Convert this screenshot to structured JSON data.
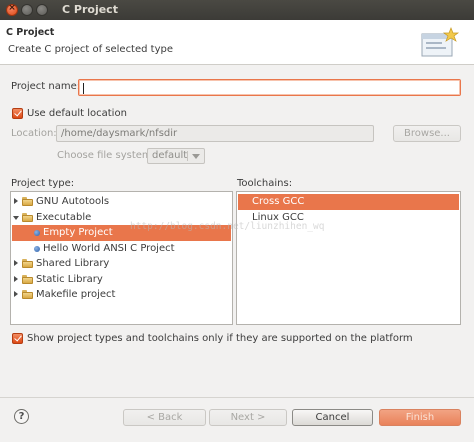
{
  "window": {
    "title": "C Project",
    "close_glyph": "×"
  },
  "header": {
    "title": "C Project",
    "description": "Create C project of selected type",
    "wizard_icon": "new-project-wizard-icon"
  },
  "form": {
    "project_name_label": "Project name:",
    "project_name_value": "",
    "use_default_location_label": "Use default location",
    "use_default_location_checked": true,
    "location_label": "Location:",
    "location_value": "/home/daysmark/nfsdir",
    "browse_label": "Browse...",
    "file_system_label": "Choose file system:",
    "file_system_value": "default"
  },
  "project_types": {
    "label": "Project type:",
    "items": [
      {
        "label": "GNU Autotools",
        "kind": "folder",
        "state": "collapsed"
      },
      {
        "label": "Executable",
        "kind": "folder",
        "state": "expanded"
      },
      {
        "label": "Empty Project",
        "kind": "leaf",
        "selected": true
      },
      {
        "label": "Hello World ANSI C Project",
        "kind": "leaf"
      },
      {
        "label": "Shared Library",
        "kind": "folder",
        "state": "collapsed"
      },
      {
        "label": "Static Library",
        "kind": "folder",
        "state": "collapsed"
      },
      {
        "label": "Makefile project",
        "kind": "folder",
        "state": "collapsed"
      }
    ]
  },
  "toolchains": {
    "label": "Toolchains:",
    "items": [
      {
        "label": "Cross GCC",
        "selected": true
      },
      {
        "label": "Linux GCC"
      }
    ]
  },
  "watermark": "http://blog.csdn.net/liunzhihen_wq",
  "filter": {
    "label": "Show project types and toolchains only if they are supported on the platform",
    "checked": true
  },
  "buttons": {
    "help": "?",
    "back": "< Back",
    "next": "Next >",
    "cancel": "Cancel",
    "finish": "Finish"
  },
  "colors": {
    "accent": "#e9764b",
    "titlebar": "#3c3b37",
    "background": "#f2f1f0"
  }
}
